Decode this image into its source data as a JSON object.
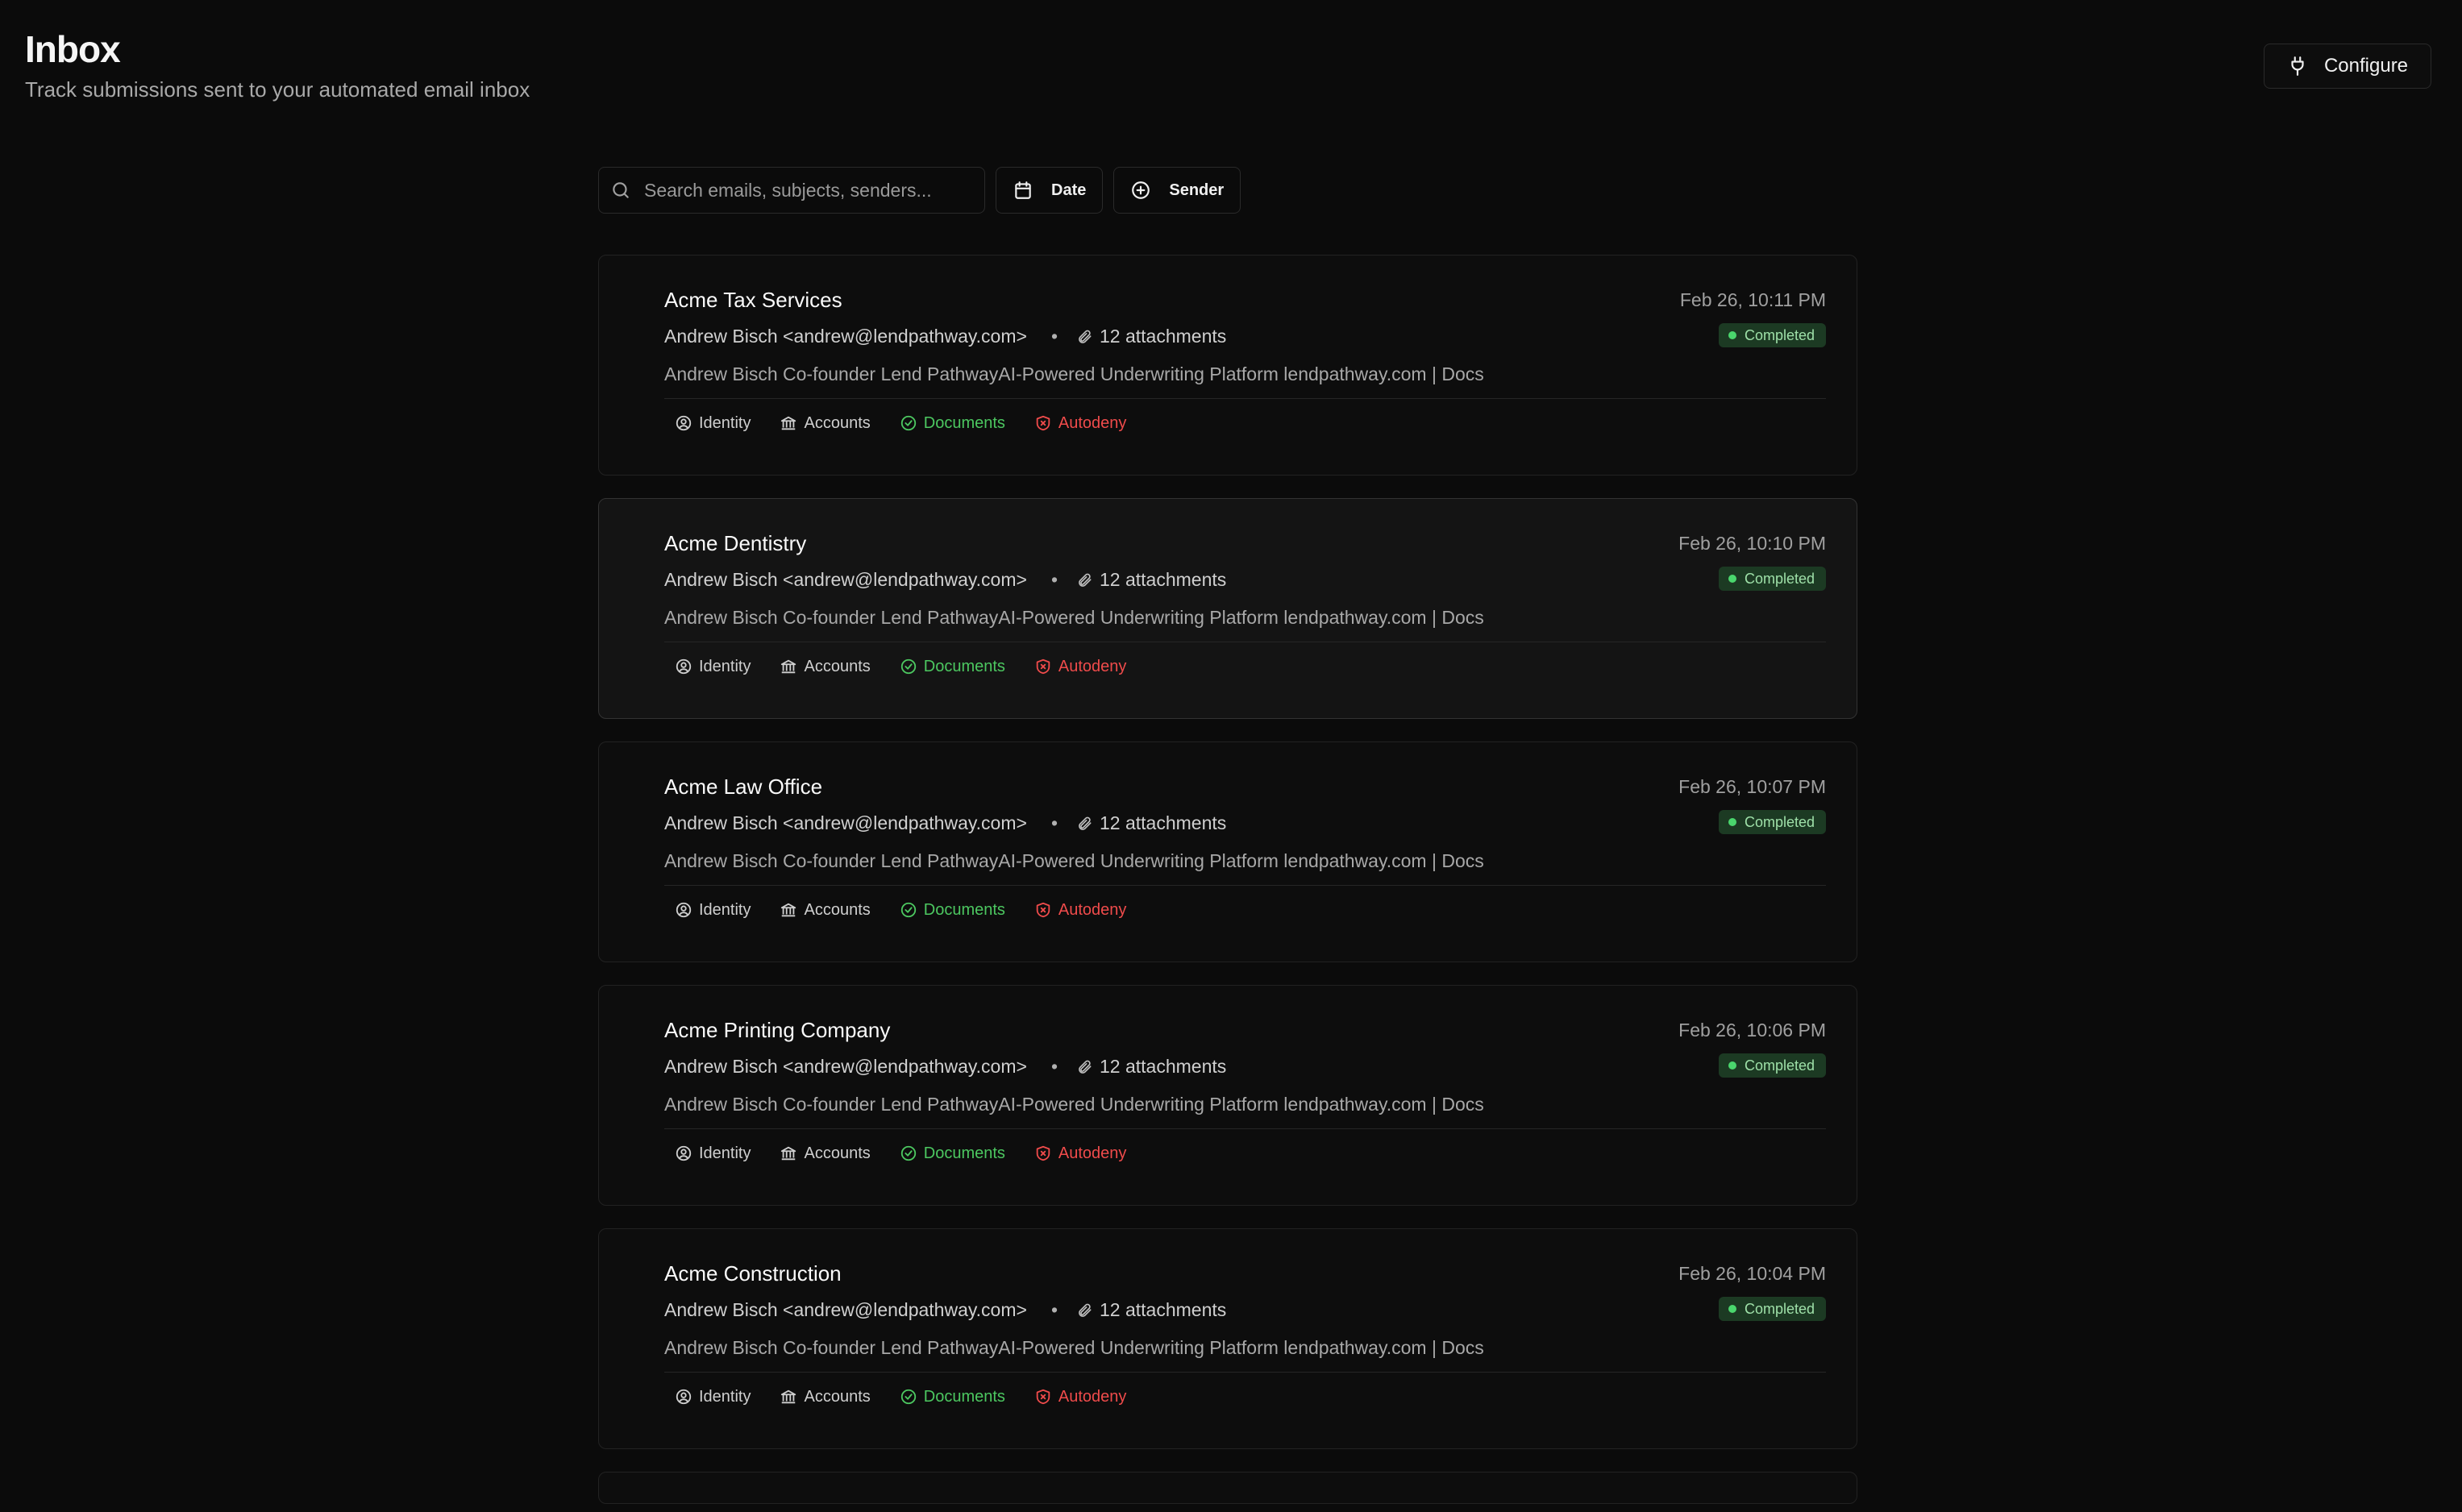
{
  "header": {
    "title": "Inbox",
    "subtitle": "Track submissions sent to your automated email inbox",
    "configure_label": "Configure"
  },
  "toolbar": {
    "search_placeholder": "Search emails, subjects, senders...",
    "date_label": "Date",
    "sender_label": "Sender"
  },
  "emails": [
    {
      "subject": "Acme Tax Services",
      "date": "Feb 26, 10:11 PM",
      "sender": "Andrew Bisch <andrew@lendpathway.com>",
      "separator": "•",
      "attachments": "12 attachments",
      "status": "Completed",
      "preview": "Andrew Bisch Co-founder Lend PathwayAI-Powered Underwriting Platform lendpathway.com | Docs",
      "tags": [
        "Identity",
        "Accounts",
        "Documents",
        "Autodeny"
      ]
    },
    {
      "subject": "Acme Dentistry",
      "date": "Feb 26, 10:10 PM",
      "sender": "Andrew Bisch <andrew@lendpathway.com>",
      "separator": "•",
      "attachments": "12 attachments",
      "status": "Completed",
      "preview": "Andrew Bisch Co-founder Lend PathwayAI-Powered Underwriting Platform lendpathway.com | Docs",
      "tags": [
        "Identity",
        "Accounts",
        "Documents",
        "Autodeny"
      ]
    },
    {
      "subject": "Acme Law Office",
      "date": "Feb 26, 10:07 PM",
      "sender": "Andrew Bisch <andrew@lendpathway.com>",
      "separator": "•",
      "attachments": "12 attachments",
      "status": "Completed",
      "preview": "Andrew Bisch Co-founder Lend PathwayAI-Powered Underwriting Platform lendpathway.com | Docs",
      "tags": [
        "Identity",
        "Accounts",
        "Documents",
        "Autodeny"
      ]
    },
    {
      "subject": "Acme Printing Company",
      "date": "Feb 26, 10:06 PM",
      "sender": "Andrew Bisch <andrew@lendpathway.com>",
      "separator": "•",
      "attachments": "12 attachments",
      "status": "Completed",
      "preview": "Andrew Bisch Co-founder Lend PathwayAI-Powered Underwriting Platform lendpathway.com | Docs",
      "tags": [
        "Identity",
        "Accounts",
        "Documents",
        "Autodeny"
      ]
    },
    {
      "subject": "Acme Construction",
      "date": "Feb 26, 10:04 PM",
      "sender": "Andrew Bisch <andrew@lendpathway.com>",
      "separator": "•",
      "attachments": "12 attachments",
      "status": "Completed",
      "preview": "Andrew Bisch Co-founder Lend PathwayAI-Powered Underwriting Platform lendpathway.com | Docs",
      "tags": [
        "Identity",
        "Accounts",
        "Documents",
        "Autodeny"
      ]
    }
  ],
  "icons": {
    "configure": "plug-icon",
    "search": "search-icon",
    "date": "calendar-icon",
    "sender": "plus-circle-icon",
    "attachments": "paperclip-icon",
    "identity": "user-circle-icon",
    "accounts": "bank-icon",
    "documents": "check-circle-icon",
    "autodeny": "shield-x-icon"
  },
  "colors": {
    "background": "#0b0b0b",
    "status_completed_bg": "#1c3a23",
    "status_completed_dot": "#4ad66d",
    "success": "#4cc760",
    "danger": "#ef4b4b"
  }
}
